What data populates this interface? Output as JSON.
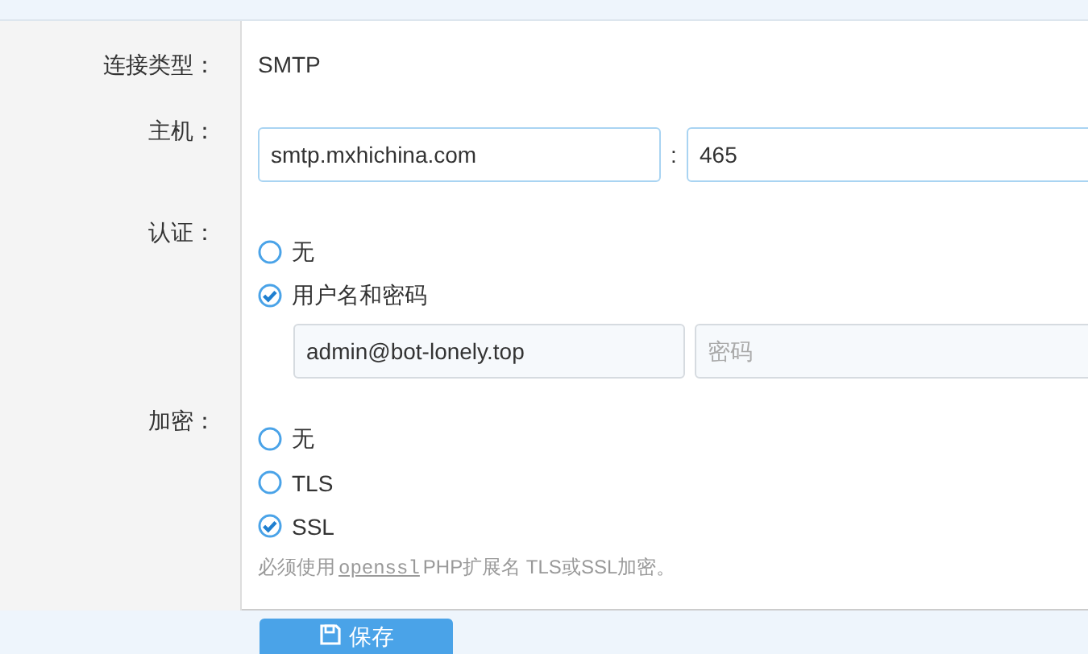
{
  "connection_type": {
    "label": "连接类型：",
    "value": "SMTP"
  },
  "host": {
    "label": "主机：",
    "host_value": "smtp.mxhichina.com",
    "separator": ":",
    "port_value": "465"
  },
  "auth": {
    "label": "认证：",
    "options": [
      {
        "label": "无",
        "selected": false
      },
      {
        "label": "用户名和密码",
        "selected": true
      }
    ],
    "username_value": "admin@bot-lonely.top",
    "password_placeholder": "密码"
  },
  "encryption": {
    "label": "加密：",
    "options": [
      {
        "label": "无",
        "selected": false
      },
      {
        "label": "TLS",
        "selected": false
      },
      {
        "label": "SSL",
        "selected": true
      }
    ],
    "note": {
      "before": "必须使用",
      "code": "openssl",
      "after": "PHP扩展名 TLS或SSL加密。"
    }
  },
  "save_button": {
    "label": "保存"
  }
}
